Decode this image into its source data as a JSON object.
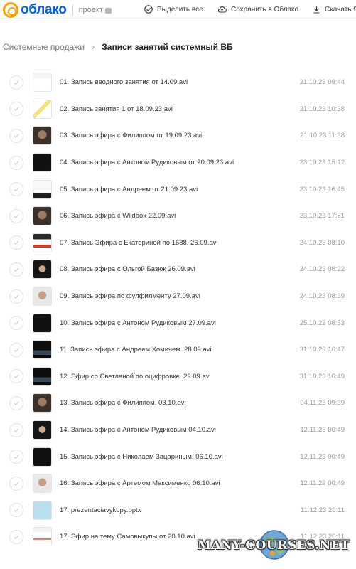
{
  "header": {
    "logo_text": "облако",
    "project_label": "проект",
    "actions": [
      {
        "label": "Выделить все",
        "icon": "check-circle-icon"
      },
      {
        "label": "Сохранить в Облако",
        "icon": "cloud-upload-icon"
      },
      {
        "label": "Скачать 9",
        "icon": "download-icon"
      }
    ]
  },
  "breadcrumb": {
    "parent": "Системные продажи",
    "current": "Записи занятий системный ВБ"
  },
  "files": [
    {
      "name": "01. Запись вводного занятия от 14.09.avi",
      "date": "21.10.23 09:44",
      "thumb": "screen-light"
    },
    {
      "name": "02. Запись занятия 1 от 18.09.23.avi",
      "date": "21.10.23 10:38",
      "thumb": "screen-yellow"
    },
    {
      "name": "03. Запись эфира с Филиппом от 19.09.23.avi",
      "date": "21.10.23 11:38",
      "thumb": "face"
    },
    {
      "name": "04. Запись эфира с Антоном Рудиковым от 20.09.23.avi",
      "date": "23.10.23 15:12",
      "thumb": "dark"
    },
    {
      "name": "05. Запись эфира с Андреем от 21.09.23.avi",
      "date": "23.10.23 16:45",
      "thumb": "screen-dark-bottom"
    },
    {
      "name": "06. Запись эфира с Wildbox 22.09.avi",
      "date": "23.10.23 17:51",
      "thumb": "face"
    },
    {
      "name": "07. Запись Эфира с Екатериной по 1688. 26.09.avi",
      "date": "24.10.23 08:10",
      "thumb": "screen-red"
    },
    {
      "name": "08. Запись эфира с Ольгой Базюк 26.09.avi",
      "date": "24.10.23 08:22",
      "thumb": "face-dark"
    },
    {
      "name": "09. Запись эфира по фулфилменту 27.09.avi",
      "date": "24.10.23 08:39",
      "thumb": "face-light"
    },
    {
      "name": "10. Запись эфира с Антоном Рудиковым 27.09.avi",
      "date": "25.10.23 08:53",
      "thumb": "dark"
    },
    {
      "name": "11. Запись эфира с Андреем Хомичем. 28.09.avi",
      "date": "31.10.23 16:47",
      "thumb": "dark-screen"
    },
    {
      "name": "12. Эфир со Светланой по оцифровке. 29.09.avi",
      "date": "31.10.23 16:49",
      "thumb": "dark-screen"
    },
    {
      "name": "13. Запись эфира с Филиппом. 03.10.avi",
      "date": "04.11.23 09:39",
      "thumb": "face"
    },
    {
      "name": "14. Запись эфира с Антоном Рудиковым 04.10.avi",
      "date": "12.11.23 00:49",
      "thumb": "face-dark"
    },
    {
      "name": "15. Запись эфира с Николаем Зацариным. 06.10.avi",
      "date": "12.11.23 00:49",
      "thumb": "dark"
    },
    {
      "name": "16. Запись эфира с Артемом Максименко 06.10.avi",
      "date": "12.11.23 00:49",
      "thumb": "face-light"
    },
    {
      "name": "17. prezentaciavykupy.pptx",
      "date": "11.12.23 20:11",
      "thumb": "slide"
    },
    {
      "name": "17. Эфир на тему Самовыкупы от 20.10.avi",
      "date": "11.12.23 20:11",
      "thumb": "screen-light-red"
    }
  ],
  "watermark": "MANY-COURSES.NET",
  "colors": {
    "brand_blue": "#005ff9",
    "brand_orange": "#ff9e00"
  }
}
